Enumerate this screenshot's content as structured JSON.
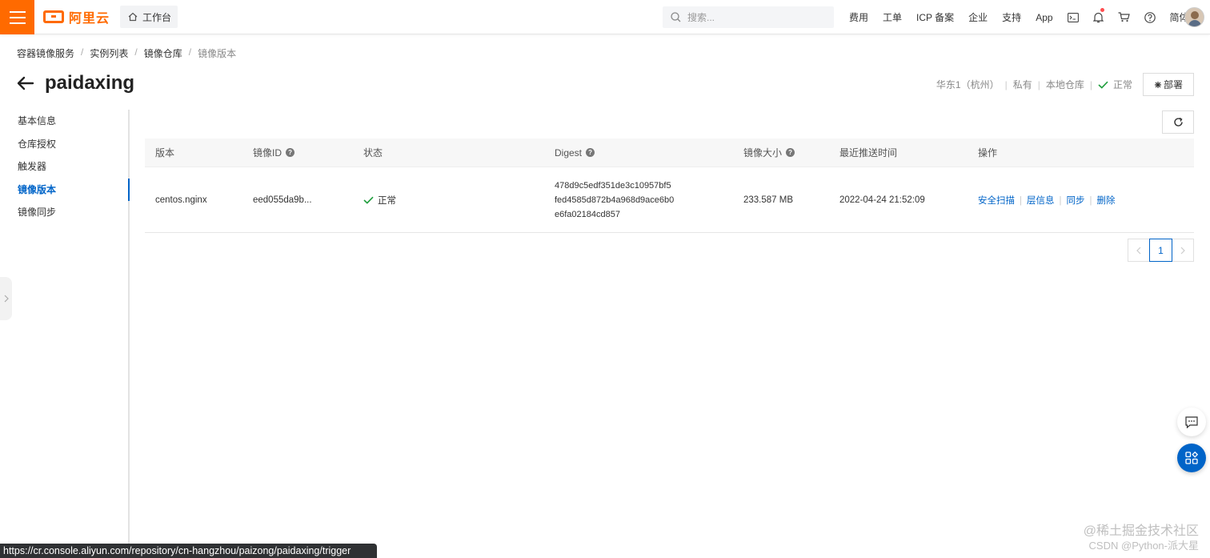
{
  "topbar": {
    "brand": "阿里云",
    "workbench": "工作台",
    "search_placeholder": "搜索...",
    "links": [
      "费用",
      "工单",
      "ICP 备案",
      "企业",
      "支持",
      "App"
    ],
    "lang": "简体"
  },
  "breadcrumb": [
    "容器镜像服务",
    "实例列表",
    "镜像仓库",
    "镜像版本"
  ],
  "header": {
    "title": "paidaxing",
    "region": "华东1（杭州）",
    "visibility": "私有",
    "repo_type": "本地仓库",
    "status": "正常",
    "deploy_label": "部署"
  },
  "sidebar": {
    "items": [
      {
        "label": "基本信息",
        "active": false
      },
      {
        "label": "仓库授权",
        "active": false
      },
      {
        "label": "触发器",
        "active": false
      },
      {
        "label": "镜像版本",
        "active": true
      },
      {
        "label": "镜像同步",
        "active": false
      }
    ]
  },
  "table": {
    "headers": {
      "version": "版本",
      "image_id": "镜像ID",
      "status": "状态",
      "digest": "Digest",
      "size": "镜像大小",
      "push_time": "最近推送时间",
      "actions": "操作"
    },
    "rows": [
      {
        "version": "centos.nginx",
        "image_id": "eed055da9b...",
        "status": "正常",
        "digest_lines": [
          "478d9c5edf351de3c10957bf5",
          "fed4585d872b4a968d9ace6b0",
          "e6fa02184cd857"
        ],
        "size": "233.587 MB",
        "push_time": "2022-04-24 21:52:09",
        "actions": [
          "安全扫描",
          "层信息",
          "同步",
          "删除"
        ]
      }
    ]
  },
  "pagination": {
    "current": "1"
  },
  "statusbar_url": "https://cr.console.aliyun.com/repository/cn-hangzhou/paizong/paidaxing/trigger",
  "watermark": {
    "line1": "@稀土掘金技术社区",
    "line2": "CSDN @Python-派大星"
  },
  "colors": {
    "brand": "#ff6a00",
    "link": "#0064c8",
    "success": "#1f9e3d"
  }
}
